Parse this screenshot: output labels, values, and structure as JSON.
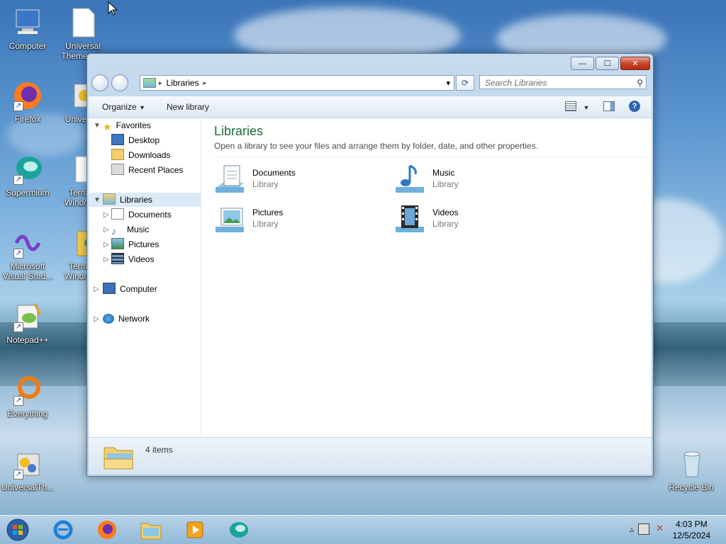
{
  "desktop": {
    "icons": [
      {
        "label": "Computer"
      },
      {
        "label": "Universal Theme W..."
      },
      {
        "label": "Firefox"
      },
      {
        "label": "Univers..."
      },
      {
        "label": "Supermium"
      },
      {
        "label": "Terna... Window..."
      },
      {
        "label": "Microsoft Visual Stud..."
      },
      {
        "label": "Terna... Window..."
      },
      {
        "label": "Notepad++"
      },
      {
        "label": "Everything"
      },
      {
        "label": "UniversalTh..."
      },
      {
        "label": "Recycle Bin"
      }
    ]
  },
  "window": {
    "caption": {
      "minimize": "—",
      "maximize": "☐",
      "close": "✕"
    },
    "address": {
      "location": "Libraries",
      "sep1": "▸",
      "sep2": "▸",
      "dropdown": "▾"
    },
    "refresh_symbol": "⟳",
    "search": {
      "placeholder": "Search Libraries",
      "icon": "⚲"
    },
    "toolbar": {
      "organize": "Organize",
      "organize_arrow": "▾",
      "new_library": "New library",
      "view_arrow": "▾",
      "help": "?"
    },
    "nav": {
      "favorites": "Favorites",
      "favorites_items": [
        "Desktop",
        "Downloads",
        "Recent Places"
      ],
      "libraries": "Libraries",
      "library_items": [
        "Documents",
        "Music",
        "Pictures",
        "Videos"
      ],
      "computer": "Computer",
      "network": "Network"
    },
    "content": {
      "title": "Libraries",
      "description": "Open a library to see your files and arrange them by folder, date, and other properties.",
      "libraries": [
        {
          "name": "Documents",
          "type": "Library"
        },
        {
          "name": "Music",
          "type": "Library"
        },
        {
          "name": "Pictures",
          "type": "Library"
        },
        {
          "name": "Videos",
          "type": "Library"
        }
      ]
    },
    "status": {
      "count": "4 items"
    }
  },
  "taskbar": {
    "clock_time": "4:03 PM",
    "clock_date": "12/5/2024"
  }
}
